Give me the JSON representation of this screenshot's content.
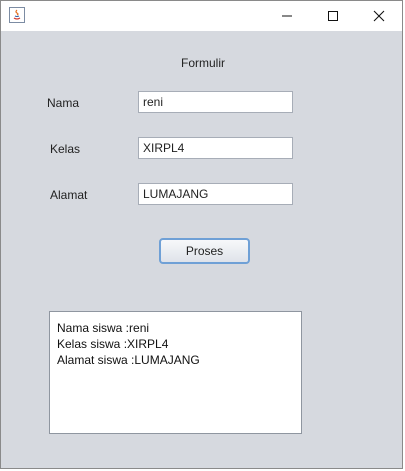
{
  "form": {
    "title": "Formulir",
    "nama_label": "Nama",
    "nama_value": "reni",
    "kelas_label": "Kelas",
    "kelas_value": "XIRPL4",
    "alamat_label": "Alamat",
    "alamat_value": "LUMAJANG",
    "proses_label": "Proses"
  },
  "output": {
    "lines": [
      "Nama siswa :reni",
      "Kelas siswa :XIRPL4",
      "Alamat siswa :LUMAJANG"
    ]
  },
  "titlebar": {
    "icons": [
      "java-app-icon",
      "minimize-icon",
      "maximize-icon",
      "close-icon"
    ]
  }
}
